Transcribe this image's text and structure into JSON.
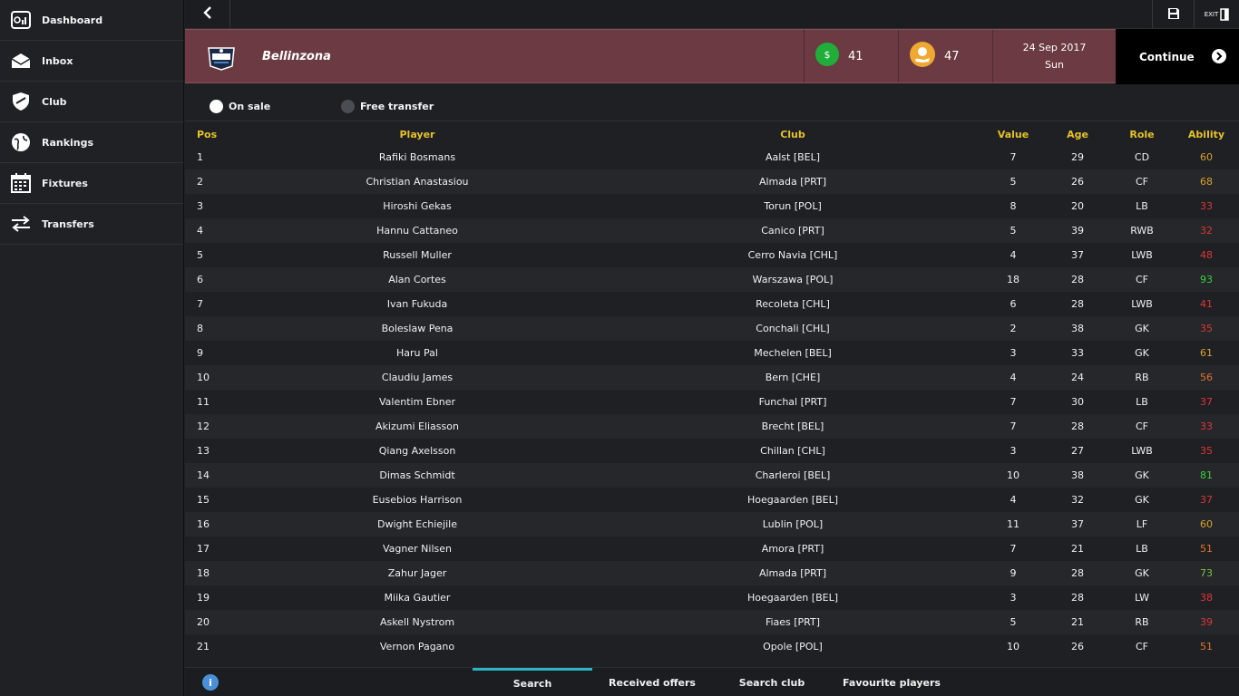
{
  "sidebar": {
    "items": [
      {
        "label": "Dashboard",
        "icon": "dashboard-icon"
      },
      {
        "label": "Inbox",
        "icon": "envelope-icon"
      },
      {
        "label": "Club",
        "icon": "shield-icon"
      },
      {
        "label": "Rankings",
        "icon": "globe-icon"
      },
      {
        "label": "Fixtures",
        "icon": "calendar-icon"
      },
      {
        "label": "Transfers",
        "icon": "transfer-arrows-icon"
      }
    ]
  },
  "topbar": {
    "back_icon": "chevron-left-icon",
    "save_icon": "floppy-disk-icon",
    "exit_label": "EXIT"
  },
  "header": {
    "club_name": "Bellinzona",
    "cash_icon": "dollar-icon",
    "cash_value": "41",
    "coin_icon": "coin-hand-icon",
    "coin_value": "47",
    "date": "24 Sep 2017",
    "day": "Sun",
    "continue_label": "Continue"
  },
  "filters": {
    "on_sale_label": "On sale",
    "on_sale_selected": true,
    "free_transfer_label": "Free transfer",
    "free_transfer_selected": false
  },
  "table": {
    "headers": {
      "pos": "Pos",
      "player": "Player",
      "club": "Club",
      "value": "Value",
      "age": "Age",
      "role": "Role",
      "ability": "Ability"
    },
    "rows": [
      {
        "pos": "1",
        "player": "Rafiki Bosmans",
        "club": "Aalst [BEL]",
        "value": "7",
        "age": "29",
        "role": "CD",
        "ability": "60",
        "ability_color": "#d9a22b"
      },
      {
        "pos": "2",
        "player": "Christian Anastasiou",
        "club": "Almada [PRT]",
        "value": "5",
        "age": "26",
        "role": "CF",
        "ability": "68",
        "ability_color": "#d9a22b"
      },
      {
        "pos": "3",
        "player": "Hiroshi Gekas",
        "club": "Torun [POL]",
        "value": "8",
        "age": "20",
        "role": "LB",
        "ability": "33",
        "ability_color": "#e03535"
      },
      {
        "pos": "4",
        "player": "Hannu Cattaneo",
        "club": "Canico [PRT]",
        "value": "5",
        "age": "39",
        "role": "RWB",
        "ability": "32",
        "ability_color": "#e03535"
      },
      {
        "pos": "5",
        "player": "Russell Muller",
        "club": "Cerro Navia [CHL]",
        "value": "4",
        "age": "37",
        "role": "LWB",
        "ability": "48",
        "ability_color": "#e03535"
      },
      {
        "pos": "6",
        "player": "Alan Cortes",
        "club": "Warszawa [POL]",
        "value": "18",
        "age": "28",
        "role": "CF",
        "ability": "93",
        "ability_color": "#3ad13a"
      },
      {
        "pos": "7",
        "player": "Ivan Fukuda",
        "club": "Recoleta [CHL]",
        "value": "6",
        "age": "28",
        "role": "LWB",
        "ability": "41",
        "ability_color": "#e03535"
      },
      {
        "pos": "8",
        "player": "Boleslaw Pena",
        "club": "Conchali [CHL]",
        "value": "2",
        "age": "38",
        "role": "GK",
        "ability": "35",
        "ability_color": "#e03535"
      },
      {
        "pos": "9",
        "player": "Haru Pal",
        "club": "Mechelen [BEL]",
        "value": "3",
        "age": "33",
        "role": "GK",
        "ability": "61",
        "ability_color": "#d9a22b"
      },
      {
        "pos": "10",
        "player": "Claudiu James",
        "club": "Bern [CHE]",
        "value": "4",
        "age": "24",
        "role": "RB",
        "ability": "56",
        "ability_color": "#e0742a"
      },
      {
        "pos": "11",
        "player": "Valentim Ebner",
        "club": "Funchal [PRT]",
        "value": "7",
        "age": "30",
        "role": "LB",
        "ability": "37",
        "ability_color": "#e03535"
      },
      {
        "pos": "12",
        "player": "Akizumi Eliasson",
        "club": "Brecht [BEL]",
        "value": "7",
        "age": "28",
        "role": "CF",
        "ability": "33",
        "ability_color": "#e03535"
      },
      {
        "pos": "13",
        "player": "Qiang Axelsson",
        "club": "Chillan [CHL]",
        "value": "3",
        "age": "27",
        "role": "LWB",
        "ability": "35",
        "ability_color": "#e03535"
      },
      {
        "pos": "14",
        "player": "Dimas Schmidt",
        "club": "Charleroi [BEL]",
        "value": "10",
        "age": "38",
        "role": "GK",
        "ability": "81",
        "ability_color": "#3ad13a"
      },
      {
        "pos": "15",
        "player": "Eusebios Harrison",
        "club": "Hoegaarden [BEL]",
        "value": "4",
        "age": "32",
        "role": "GK",
        "ability": "37",
        "ability_color": "#e03535"
      },
      {
        "pos": "16",
        "player": "Dwight Echiejile",
        "club": "Lublin [POL]",
        "value": "11",
        "age": "37",
        "role": "LF",
        "ability": "60",
        "ability_color": "#d9a22b"
      },
      {
        "pos": "17",
        "player": "Vagner Nilsen",
        "club": "Amora [PRT]",
        "value": "7",
        "age": "21",
        "role": "LB",
        "ability": "51",
        "ability_color": "#e0742a"
      },
      {
        "pos": "18",
        "player": "Zahur Jager",
        "club": "Almada [PRT]",
        "value": "9",
        "age": "28",
        "role": "GK",
        "ability": "73",
        "ability_color": "#7cc43a"
      },
      {
        "pos": "19",
        "player": "Miika Gautier",
        "club": "Hoegaarden [BEL]",
        "value": "3",
        "age": "28",
        "role": "LW",
        "ability": "38",
        "ability_color": "#e03535"
      },
      {
        "pos": "20",
        "player": "Askell Nystrom",
        "club": "Fiaes [PRT]",
        "value": "5",
        "age": "21",
        "role": "RB",
        "ability": "39",
        "ability_color": "#e03535"
      },
      {
        "pos": "21",
        "player": "Vernon Pagano",
        "club": "Opole [POL]",
        "value": "10",
        "age": "26",
        "role": "CF",
        "ability": "51",
        "ability_color": "#e0742a"
      }
    ]
  },
  "bottom_tabs": {
    "info_icon": "info-icon",
    "tabs": [
      {
        "label": "Search",
        "active": true
      },
      {
        "label": "Received offers",
        "active": false
      },
      {
        "label": "Search club",
        "active": false
      },
      {
        "label": "Favourite players",
        "active": false
      }
    ]
  },
  "colors": {
    "accent_tab": "#28b5c8",
    "header_band": "#6b3a42",
    "column_header": "#e6c229",
    "ability_high": "#3ad13a",
    "ability_mid": "#d9a22b",
    "ability_low": "#e03535"
  }
}
